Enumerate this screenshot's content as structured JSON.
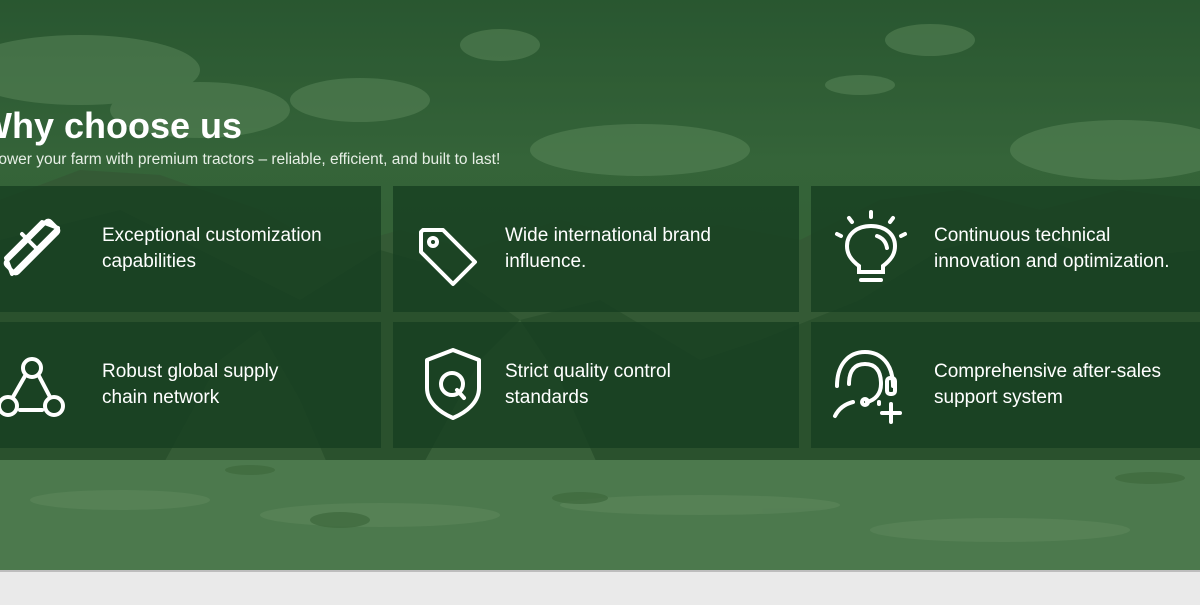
{
  "section": {
    "title": "Why choose us",
    "subtitle": "Power your farm with premium tractors – reliable, efficient, and built to last!"
  },
  "features": [
    {
      "icon": "tools-icon",
      "line1": "Exceptional customization",
      "line2": "capabilities"
    },
    {
      "icon": "price-tag-icon",
      "line1": "Wide international brand",
      "line2": "influence."
    },
    {
      "icon": "lightbulb-icon",
      "line1": "Continuous technical",
      "line2": "innovation and optimization."
    },
    {
      "icon": "network-icon",
      "line1": "Robust global supply",
      "line2": "chain network"
    },
    {
      "icon": "shield-q-icon",
      "line1": "Strict quality control",
      "line2": "standards"
    },
    {
      "icon": "customer-support-icon",
      "line1": "Comprehensive after-sales",
      "line2": "support system"
    }
  ],
  "colors": {
    "overlay_green": "#1f4f28",
    "card_background": "#163e20",
    "text": "#ffffff"
  }
}
